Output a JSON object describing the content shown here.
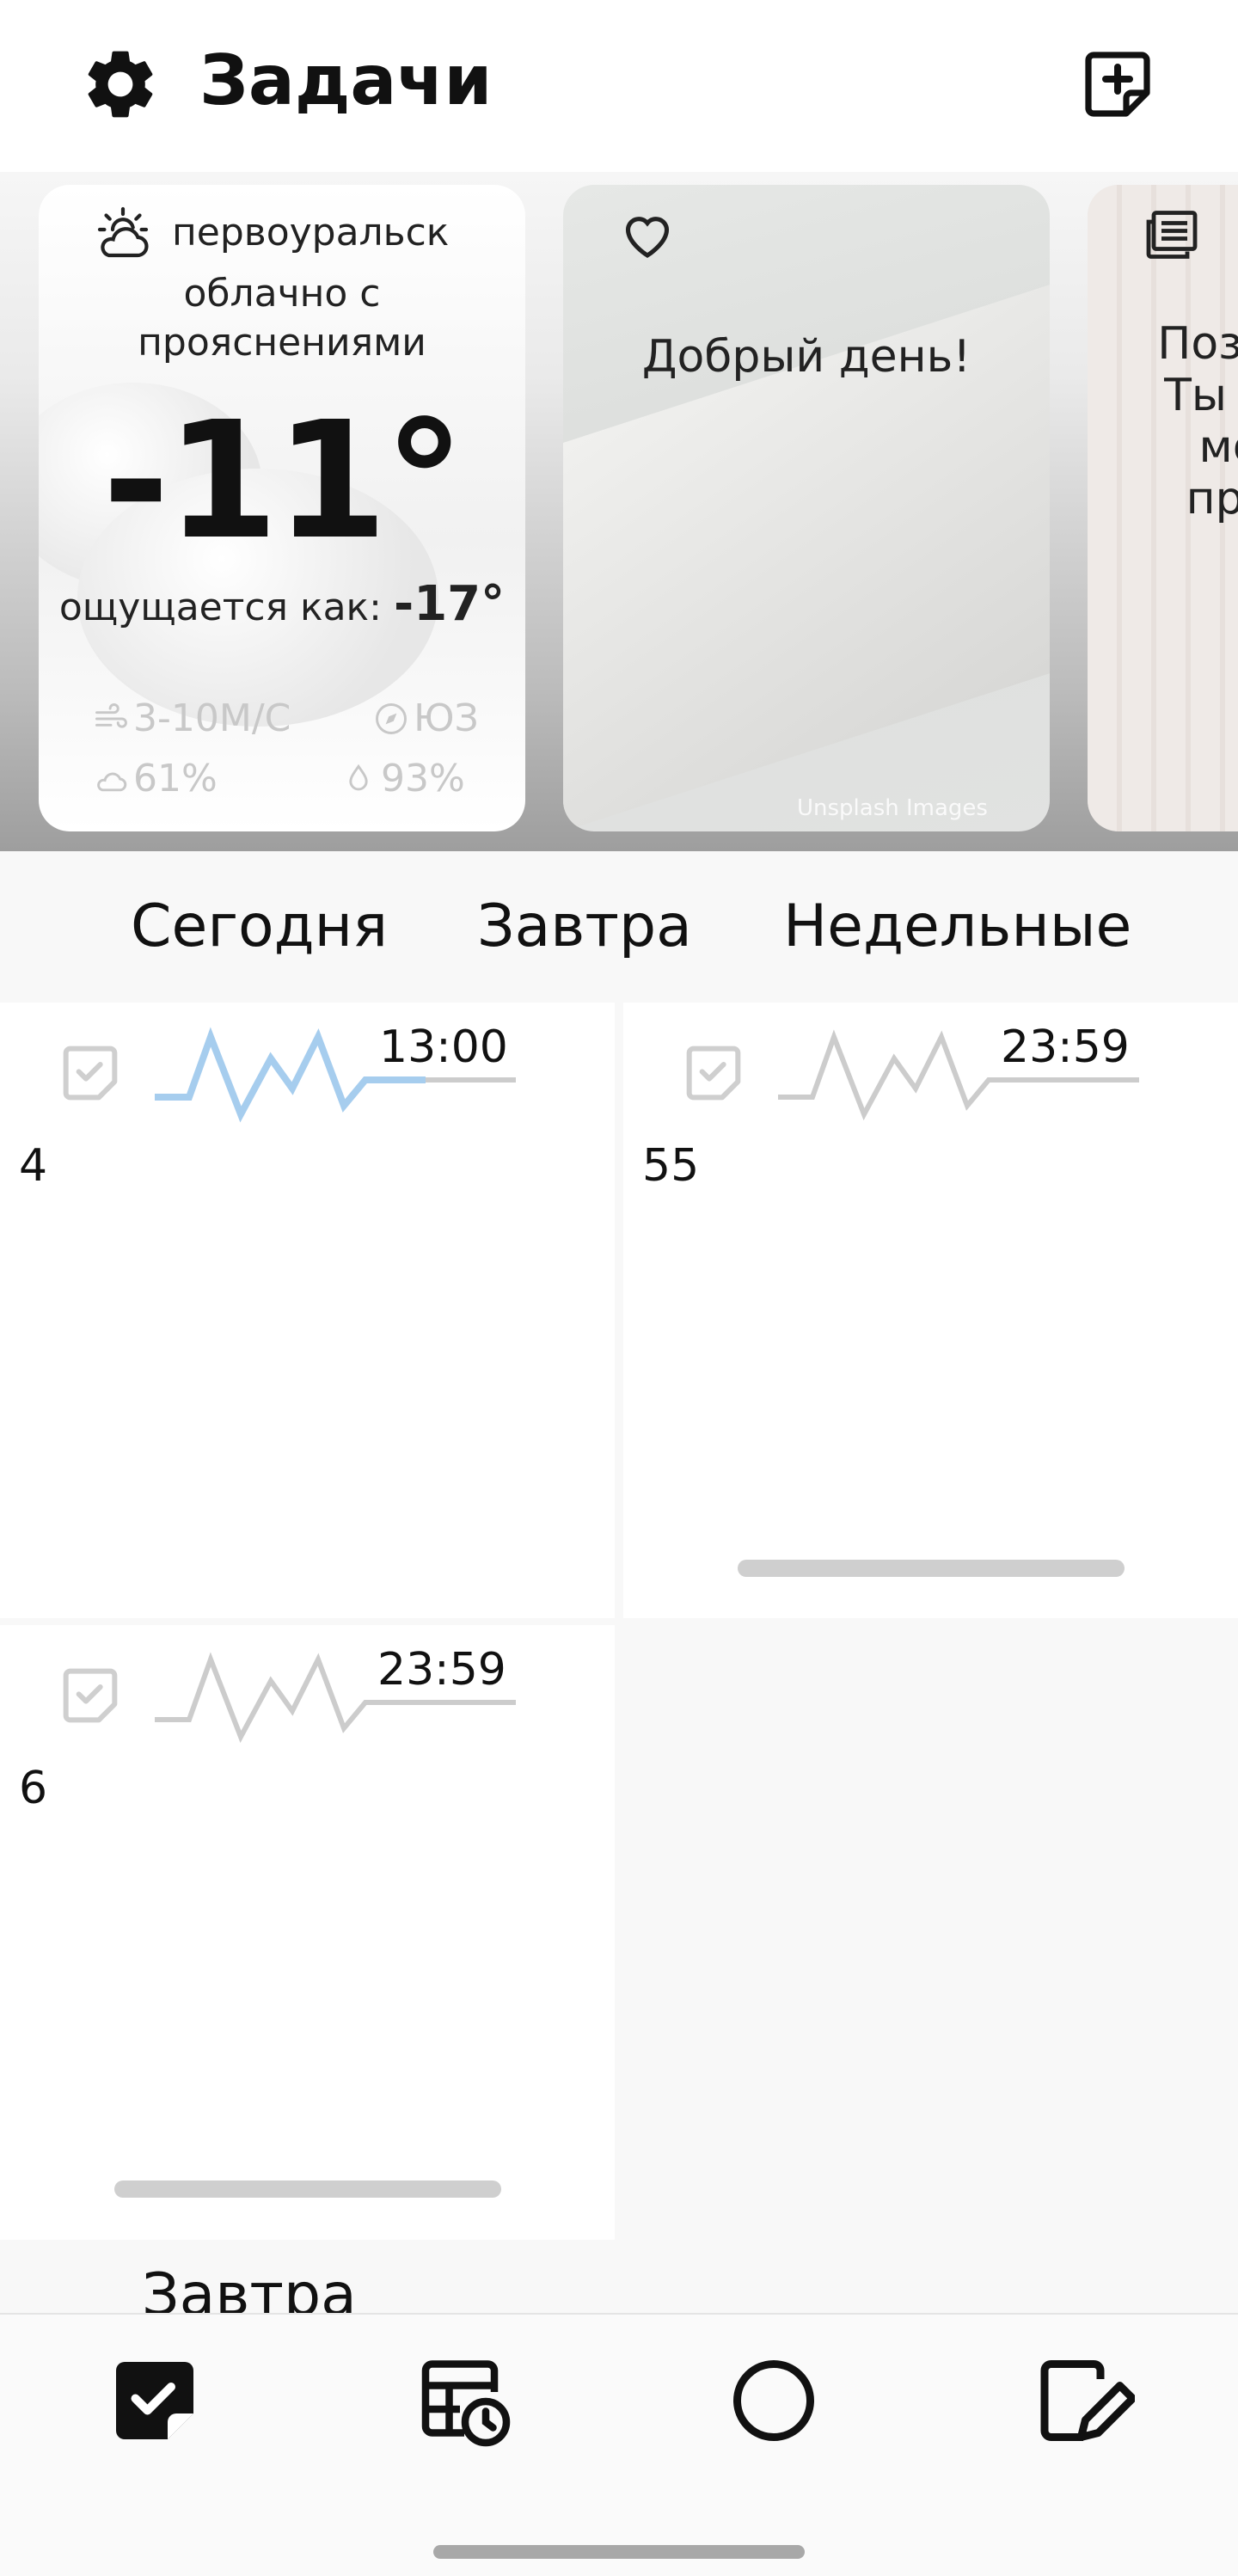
{
  "header": {
    "title": "Задачи",
    "settings_icon": "gear-icon",
    "add_icon": "add-note-icon"
  },
  "weather": {
    "city": "первоуральск",
    "description_line1": "облачно с",
    "description_line2": "прояснениями",
    "temperature": "-11°",
    "feels_label": "ощущается как:",
    "feels_value": "-17°",
    "wind": "3-10М/С",
    "direction": "ЮЗ",
    "cloudiness": "61%",
    "humidity": "93%"
  },
  "greeting": {
    "text": "Добрый день!",
    "credit": "Unsplash Images"
  },
  "news": {
    "line1": "Поздр",
    "line2": "Ты те",
    "line3": "мо",
    "line4": "при"
  },
  "tabs": [
    "Сегодня",
    "Завтра",
    "Недельные"
  ],
  "tasks": [
    {
      "time": "13:00",
      "number": "4"
    },
    {
      "time": "23:59",
      "number": "55"
    },
    {
      "time": "23:59",
      "number": "6"
    }
  ],
  "next_section": "Завтра",
  "colors": {
    "wave_active": "#a6cdee",
    "wave_inactive": "#cccccc"
  }
}
